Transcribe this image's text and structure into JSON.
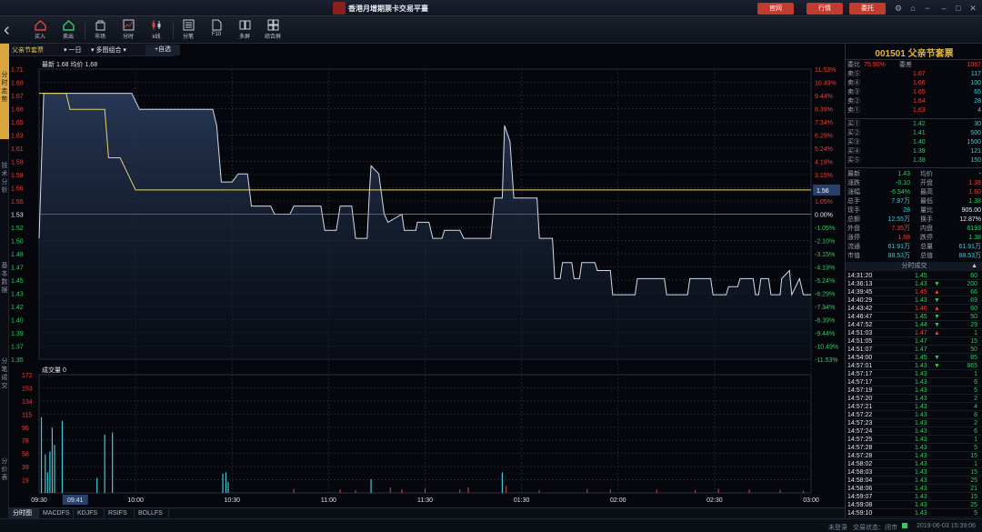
{
  "app": {
    "title": "香港月增期票卡交易平臺",
    "buttons": [
      "官网",
      "行情",
      "委托"
    ]
  },
  "toolbar": {
    "items": [
      "买入",
      "卖出",
      "市场",
      "分时",
      "k线",
      "分笔",
      "F10",
      "多屏",
      "综合屏"
    ]
  },
  "left_tabs": [
    "分时走势",
    "技术分析",
    "基本数据",
    "分笔成交",
    "分价表"
  ],
  "chart_head": {
    "name": "父亲节套票",
    "period": "一日",
    "mode": "多图组合",
    "add": "+自选"
  },
  "chart_data": {
    "type": "line",
    "info": "最新 1.68 均价 1.68",
    "volume_label": "成交量 0",
    "price_ticks": [
      "1.71",
      "1.69",
      "1.67",
      "1.66",
      "1.65",
      "1.63",
      "1.61",
      "1.59",
      "1.58",
      "1.56",
      "1.55",
      "1.53",
      "1.52",
      "1.50",
      "1.48",
      "1.47",
      "1.45",
      "1.43",
      "1.42",
      "1.40",
      "1.39",
      "1.37",
      "1.35"
    ],
    "pct_ticks": [
      "11.53%",
      "10.49%",
      "9.44%",
      "8.39%",
      "7.34%",
      "6.29%",
      "5.24%",
      "4.19%",
      "3.15%",
      "2.10%",
      "1.05%",
      "0.00%",
      "-1.05%",
      "-2.10%",
      "-3.15%",
      "-4.19%",
      "-5.24%",
      "-6.29%",
      "-7.34%",
      "-8.39%",
      "-9.44%",
      "-10.49%",
      "-11.53%"
    ],
    "vol_ticks": [
      "172",
      "153",
      "134",
      "115",
      "96",
      "78",
      "58",
      "39",
      "19"
    ],
    "time_ticks": [
      "09:30",
      "09:41",
      "10:00",
      "10:30",
      "11:00",
      "11:30",
      "01:30",
      "02:00",
      "02:30",
      "03:00"
    ],
    "time_values": [
      0,
      0.0375,
      0.1,
      0.2,
      0.3,
      0.4,
      0.5,
      0.6,
      0.7,
      0.8
    ],
    "ylim": [
      1.35,
      1.71
    ],
    "prev_close": 1.53,
    "current_label": "1.56",
    "price_series": [
      [
        0,
        1.5
      ],
      [
        0.006,
        1.68
      ],
      [
        0.12,
        1.68
      ],
      [
        0.13,
        1.66
      ],
      [
        0.225,
        1.66
      ],
      [
        0.23,
        1.64
      ],
      [
        0.236,
        1.57
      ],
      [
        0.25,
        1.57
      ],
      [
        0.258,
        1.58
      ],
      [
        0.27,
        1.58
      ],
      [
        0.275,
        1.54
      ],
      [
        0.3,
        1.54
      ],
      [
        0.305,
        1.53
      ],
      [
        0.325,
        1.53
      ],
      [
        0.33,
        1.54
      ],
      [
        0.345,
        1.54
      ],
      [
        0.35,
        1.54
      ],
      [
        0.365,
        1.54
      ],
      [
        0.37,
        1.51
      ],
      [
        0.385,
        1.51
      ],
      [
        0.39,
        1.54
      ],
      [
        0.405,
        1.54
      ],
      [
        0.41,
        1.5
      ],
      [
        0.425,
        1.5
      ],
      [
        0.428,
        1.56
      ],
      [
        0.43,
        1.59
      ],
      [
        0.44,
        1.58
      ],
      [
        0.447,
        1.53
      ],
      [
        0.452,
        1.52
      ],
      [
        0.47,
        1.53
      ],
      [
        0.473,
        1.51
      ],
      [
        0.488,
        1.51
      ],
      [
        0.49,
        1.52
      ],
      [
        0.505,
        1.52
      ],
      [
        0.51,
        1.5
      ],
      [
        0.522,
        1.5
      ],
      [
        0.525,
        1.51
      ],
      [
        0.545,
        1.51
      ],
      [
        0.55,
        1.5
      ],
      [
        0.585,
        1.5
      ],
      [
        0.59,
        1.55
      ],
      [
        0.6,
        1.55
      ],
      [
        0.603,
        1.64
      ],
      [
        0.61,
        1.62
      ],
      [
        0.615,
        1.55
      ],
      [
        0.645,
        1.55
      ],
      [
        0.648,
        1.5
      ],
      [
        0.665,
        1.5
      ],
      [
        0.668,
        1.45
      ],
      [
        0.675,
        1.45
      ],
      [
        0.678,
        1.47
      ],
      [
        0.69,
        1.47
      ],
      [
        0.693,
        1.45
      ],
      [
        0.7,
        1.45
      ],
      [
        0.703,
        1.47
      ],
      [
        0.72,
        1.47
      ],
      [
        0.723,
        1.46
      ],
      [
        0.74,
        1.46
      ],
      [
        0.743,
        1.43
      ],
      [
        0.772,
        1.43
      ],
      [
        0.775,
        1.45
      ],
      [
        0.81,
        1.45
      ],
      [
        0.813,
        1.43
      ],
      [
        0.84,
        1.43
      ],
      [
        0.843,
        1.45
      ],
      [
        0.87,
        1.45
      ],
      [
        0.873,
        1.43
      ],
      [
        0.89,
        1.43
      ],
      [
        0.893,
        1.44
      ],
      [
        0.905,
        1.44
      ],
      [
        0.908,
        1.45
      ],
      [
        0.925,
        1.45
      ],
      [
        0.928,
        1.43
      ],
      [
        0.932,
        1.43
      ],
      [
        0.935,
        1.45
      ],
      [
        0.945,
        1.45
      ],
      [
        0.948,
        1.43
      ],
      [
        0.96,
        1.43
      ],
      [
        0.962,
        1.45
      ],
      [
        0.972,
        1.46
      ],
      [
        0.975,
        1.43
      ],
      [
        0.985,
        1.45
      ],
      [
        0.99,
        1.43
      ],
      [
        1,
        1.43
      ]
    ],
    "avg_series": [
      [
        0,
        1.68
      ],
      [
        0.035,
        1.68
      ],
      [
        0.04,
        1.66
      ],
      [
        0.085,
        1.66
      ],
      [
        0.09,
        1.6
      ],
      [
        0.105,
        1.6
      ],
      [
        0.115,
        1.58
      ],
      [
        0.125,
        1.56
      ],
      [
        0.3,
        1.56
      ],
      [
        1,
        1.56
      ]
    ],
    "volume_ylim": [
      0,
      172
    ],
    "volume_bars": [
      [
        0.003,
        110
      ],
      [
        0.008,
        56
      ],
      [
        0.011,
        30
      ],
      [
        0.014,
        60
      ],
      [
        0.017,
        95
      ],
      [
        0.02,
        70
      ],
      [
        0.03,
        105
      ],
      [
        0.075,
        22
      ],
      [
        0.085,
        85
      ],
      [
        0.095,
        88
      ],
      [
        0.238,
        28
      ],
      [
        0.242,
        30
      ],
      [
        0.245,
        16
      ],
      [
        0.33,
        6
      ],
      [
        0.39,
        5
      ],
      [
        0.41,
        4
      ],
      [
        0.43,
        20
      ],
      [
        0.455,
        8
      ],
      [
        0.47,
        5
      ],
      [
        0.47,
        5
      ],
      [
        0.5,
        6
      ],
      [
        0.545,
        5
      ],
      [
        0.556,
        8
      ],
      [
        0.6,
        30
      ],
      [
        0.605,
        10
      ],
      [
        0.648,
        4
      ],
      [
        0.71,
        6
      ],
      [
        0.74,
        5
      ],
      [
        0.8,
        5
      ],
      [
        0.85,
        4
      ],
      [
        0.88,
        6
      ],
      [
        0.92,
        5
      ],
      [
        0.96,
        4
      ],
      [
        0.99,
        3
      ]
    ]
  },
  "right": {
    "title": "001501 父亲节套票",
    "weibi": {
      "l": "委比",
      "v": "75.90%",
      "l2": "委差",
      "v2": "1087"
    },
    "sells": [
      [
        "卖⑤",
        "1.67",
        "117"
      ],
      [
        "卖④",
        "1.66",
        "100"
      ],
      [
        "卖③",
        "1.65",
        "65"
      ],
      [
        "卖②",
        "1.64",
        "28"
      ],
      [
        "卖①",
        "1.63",
        "4"
      ]
    ],
    "buys": [
      [
        "买①",
        "1.42",
        "30"
      ],
      [
        "买②",
        "1.41",
        "500"
      ],
      [
        "买③",
        "1.40",
        "1500"
      ],
      [
        "买④",
        "1.39",
        "121"
      ],
      [
        "买⑤",
        "1.38",
        "150"
      ]
    ],
    "stats": [
      [
        "最新",
        "1.43",
        "均价",
        "-"
      ],
      [
        "涨跌",
        "-0.10",
        "开盘",
        "1.38"
      ],
      [
        "涨幅",
        "-6.54%",
        "最高",
        "1.60"
      ],
      [
        "总手",
        "7.97万",
        "最低",
        "1.38"
      ],
      [
        "现手",
        "28",
        "量比",
        "905.00"
      ],
      [
        "总额",
        "12.55万",
        "换手",
        "12.87%"
      ],
      [
        "外盘",
        "7.35万",
        "内盘",
        "6193"
      ],
      [
        "涨停",
        "1.68",
        "跌停",
        "1.38"
      ],
      [
        "流通",
        "61.91万",
        "总量",
        "61.91万"
      ],
      [
        "市值",
        "88.53万",
        "总值",
        "88.53万"
      ]
    ],
    "ticks_header": "分时成交",
    "ticks": [
      [
        "14:31:20",
        "1.45",
        "",
        "60"
      ],
      [
        "14:36:13",
        "1.43",
        "▼",
        "200"
      ],
      [
        "14:39:45",
        "1.45",
        "▲",
        "66"
      ],
      [
        "14:40:29",
        "1.43",
        "▼",
        "69"
      ],
      [
        "14:43:42",
        "1.46",
        "▲",
        "60"
      ],
      [
        "14:46:47",
        "1.45",
        "▼",
        "50"
      ],
      [
        "14:47:52",
        "1.44",
        "▼",
        "29"
      ],
      [
        "14:51:03",
        "1.47",
        "▲",
        "1"
      ],
      [
        "14:51:05",
        "1.47",
        "",
        "15"
      ],
      [
        "14:51:07",
        "1.47",
        "",
        "50"
      ],
      [
        "14:54:00",
        "1.45",
        "▼",
        "85"
      ],
      [
        "14:57:01",
        "1.43",
        "▼",
        "865"
      ],
      [
        "14:57:17",
        "1.43",
        "",
        "1"
      ],
      [
        "14:57:17",
        "1.43",
        "",
        "6"
      ],
      [
        "14:57:19",
        "1.43",
        "",
        "5"
      ],
      [
        "14:57:20",
        "1.43",
        "",
        "2"
      ],
      [
        "14:57:21",
        "1.43",
        "",
        "4"
      ],
      [
        "14:57:22",
        "1.43",
        "",
        "8"
      ],
      [
        "14:57:23",
        "1.43",
        "",
        "2"
      ],
      [
        "14:57:24",
        "1.43",
        "",
        "6"
      ],
      [
        "14:57:25",
        "1.43",
        "",
        "1"
      ],
      [
        "14:57:28",
        "1.43",
        "",
        "5"
      ],
      [
        "14:57:28",
        "1.43",
        "",
        "15"
      ],
      [
        "14:58:02",
        "1.43",
        "",
        "1"
      ],
      [
        "14:58:03",
        "1.43",
        "",
        "15"
      ],
      [
        "14:58:04",
        "1.43",
        "",
        "25"
      ],
      [
        "14:58:06",
        "1.43",
        "",
        "21"
      ],
      [
        "14:59:07",
        "1.43",
        "",
        "15"
      ],
      [
        "14:59:08",
        "1.43",
        "",
        "25"
      ],
      [
        "14:59:10",
        "1.43",
        "",
        "5"
      ]
    ]
  },
  "bottom_tabs": [
    "分时图",
    "MACDFS",
    "KDJFS",
    "RSIFS",
    "BOLLFS"
  ],
  "status": {
    "left": "未登录",
    "mid": "交易状态：闭市",
    "time": "2019-06-03 15:39:06"
  }
}
